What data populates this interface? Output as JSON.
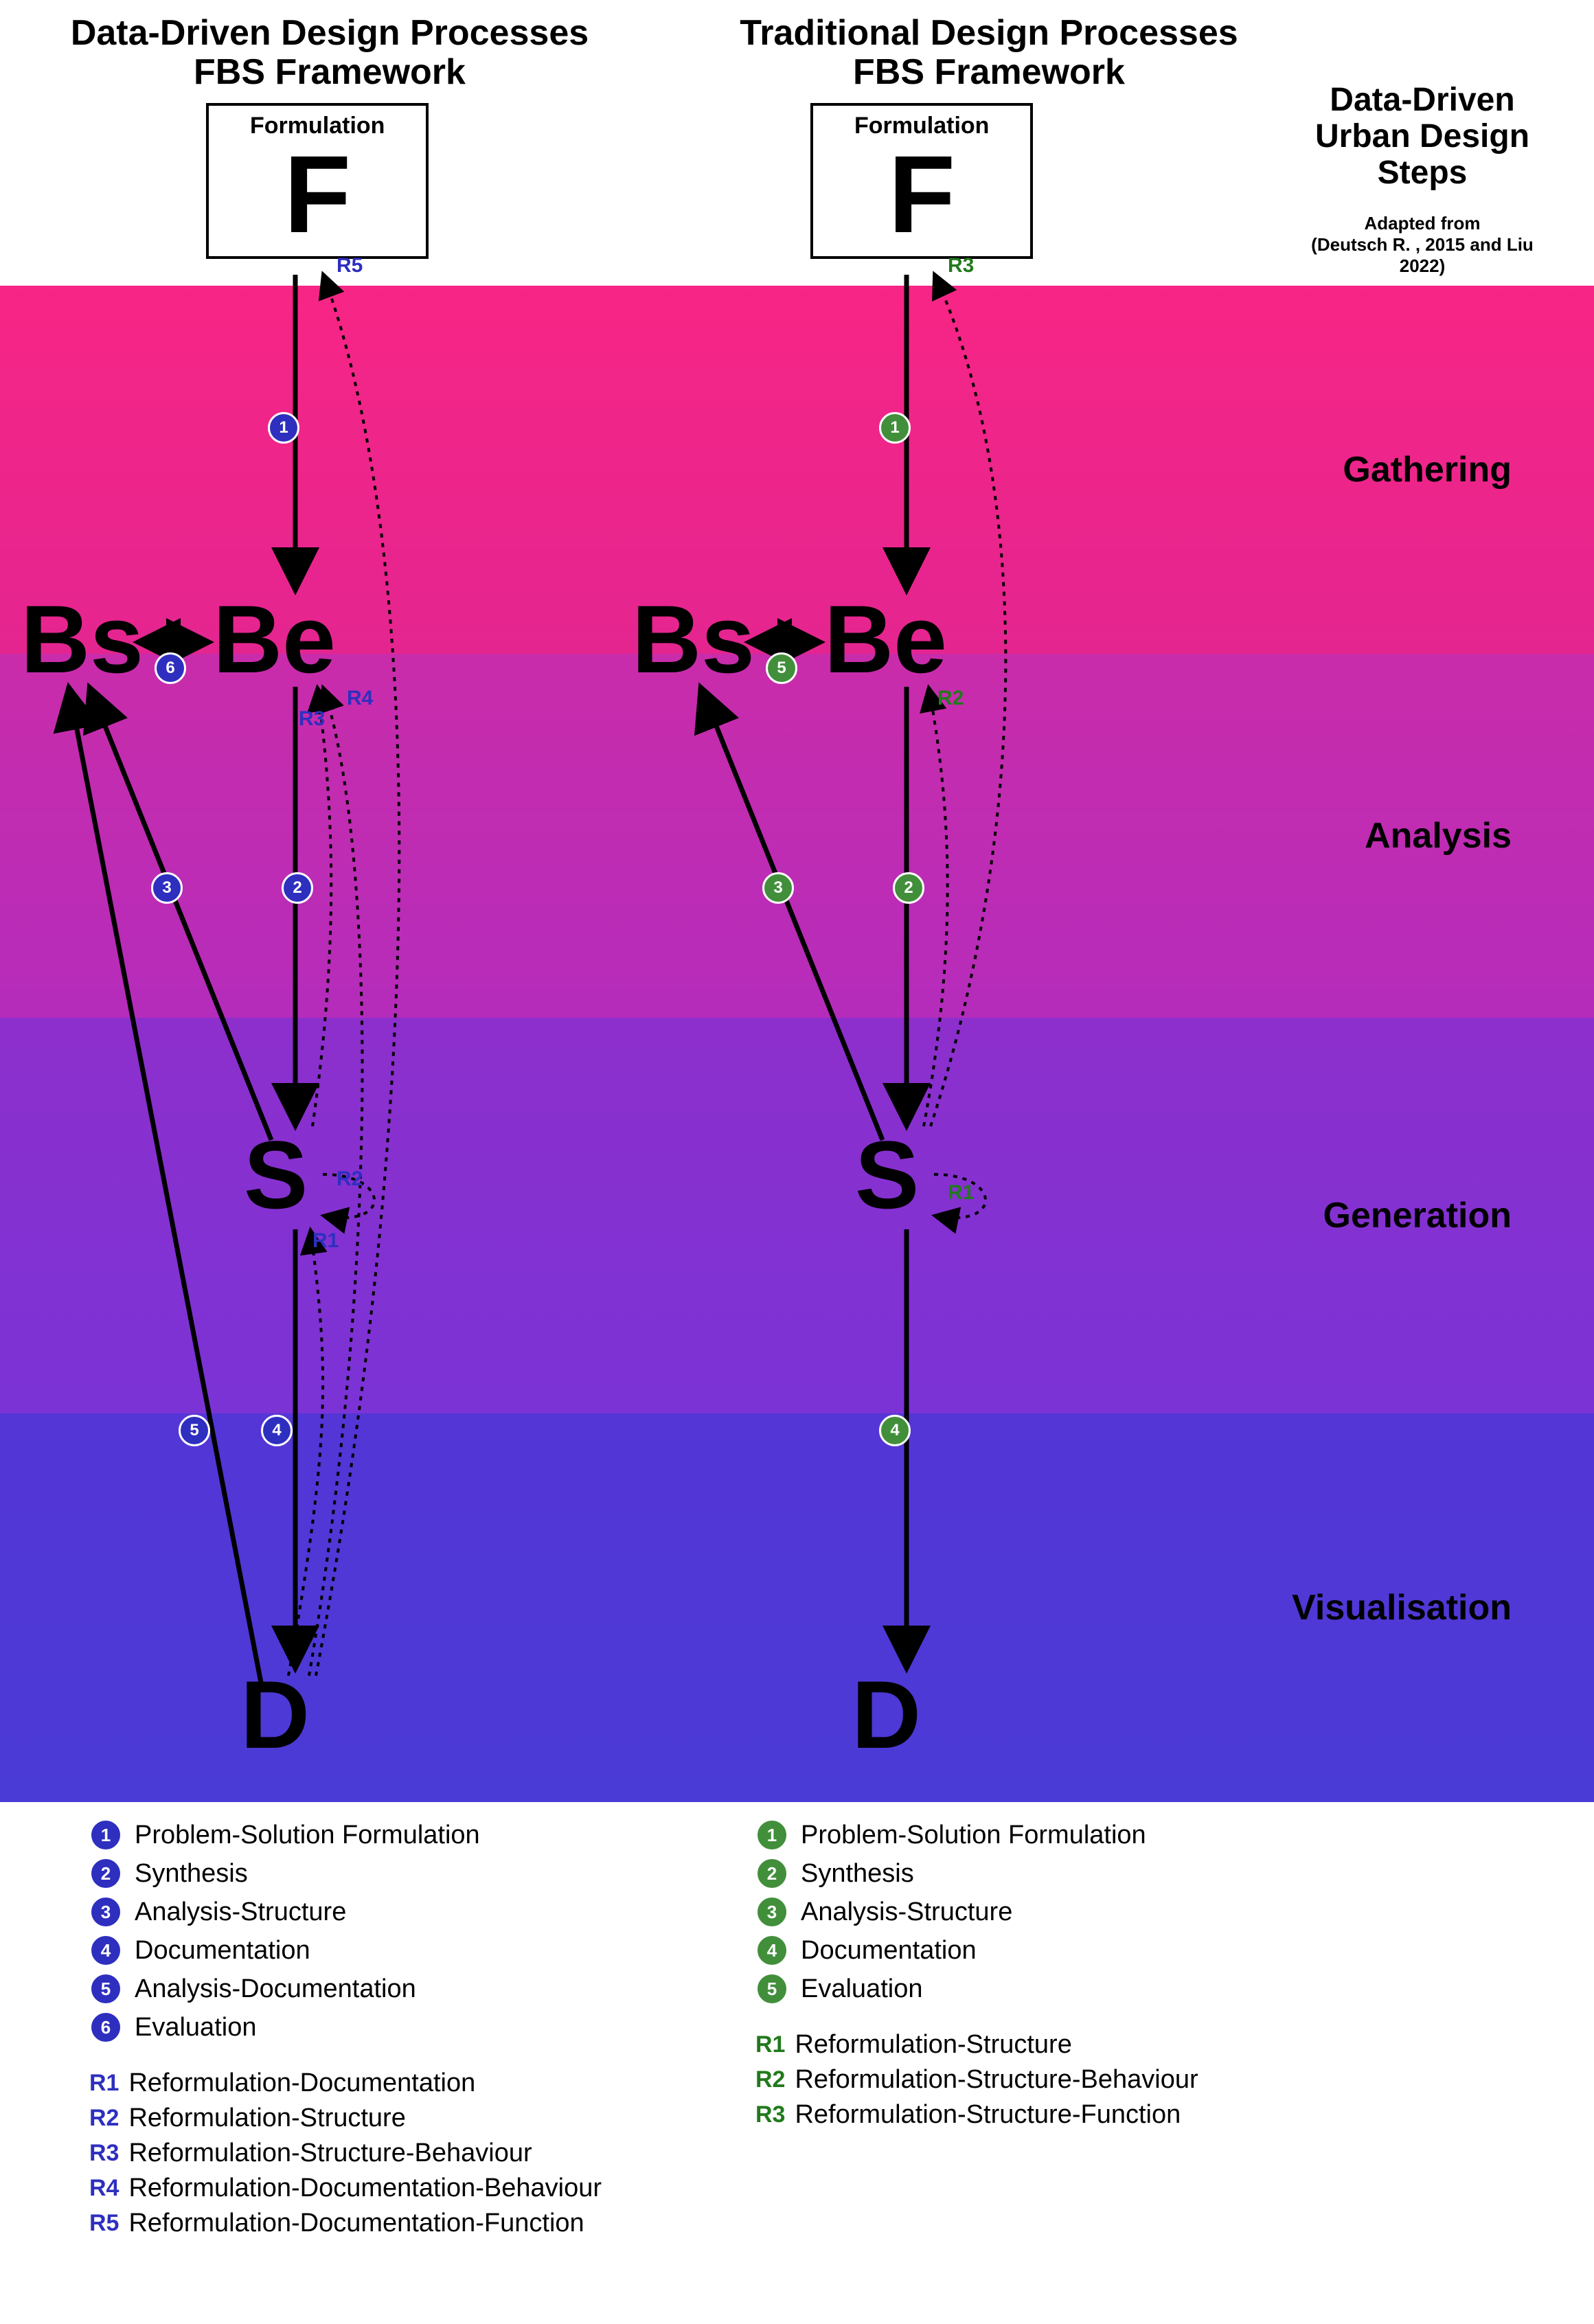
{
  "titleLeft1": "Data-Driven Design Processes",
  "titleLeft2": "FBS Framework",
  "titleRight1": "Traditional Design Processes",
  "titleRight2": "FBS Framework",
  "sideTitle1": "Data-Driven",
  "sideTitle2": "Urban Design",
  "sideTitle3": "Steps",
  "sideSub1": "Adapted from",
  "sideSub2": "(Deutsch R. , 2015 and Liu 2022)",
  "bands": {
    "gathering": "Gathering",
    "analysis": "Analysis",
    "generation": "Generation",
    "visualisation": "Visualisation"
  },
  "nodes": {
    "formulationLabel": "Formulation",
    "F": "F",
    "Bs": "Bs",
    "Be": "Be",
    "S": "S",
    "D": "D"
  },
  "left": {
    "color": "blue",
    "steps": [
      {
        "n": "1",
        "label": "Problem-Solution Formulation"
      },
      {
        "n": "2",
        "label": "Synthesis"
      },
      {
        "n": "3",
        "label": "Analysis-Structure"
      },
      {
        "n": "4",
        "label": "Documentation"
      },
      {
        "n": "5",
        "label": "Analysis-Documentation"
      },
      {
        "n": "6",
        "label": "Evaluation"
      }
    ],
    "reforms": [
      {
        "r": "R1",
        "label": "Reformulation-Documentation"
      },
      {
        "r": "R2",
        "label": "Reformulation-Structure"
      },
      {
        "r": "R3",
        "label": "Reformulation-Structure-Behaviour"
      },
      {
        "r": "R4",
        "label": "Reformulation-Documentation-Behaviour"
      },
      {
        "r": "R5",
        "label": "Reformulation-Documentation-Function"
      }
    ]
  },
  "right": {
    "color": "green",
    "steps": [
      {
        "n": "1",
        "label": "Problem-Solution Formulation"
      },
      {
        "n": "2",
        "label": "Synthesis"
      },
      {
        "n": "3",
        "label": "Analysis-Structure"
      },
      {
        "n": "4",
        "label": "Documentation"
      },
      {
        "n": "5",
        "label": "Evaluation"
      }
    ],
    "reforms": [
      {
        "r": "R1",
        "label": "Reformulation-Structure"
      },
      {
        "r": "R2",
        "label": "Reformulation-Structure-Behaviour"
      },
      {
        "r": "R3",
        "label": "Reformulation-Structure-Function"
      }
    ]
  },
  "rOnDiagramLeft": {
    "R1": "R1",
    "R2": "R2",
    "R3": "R3",
    "R4": "R4",
    "R5": "R5"
  },
  "rOnDiagramRight": {
    "R1": "R1",
    "R2": "R2",
    "R3": "R3"
  }
}
